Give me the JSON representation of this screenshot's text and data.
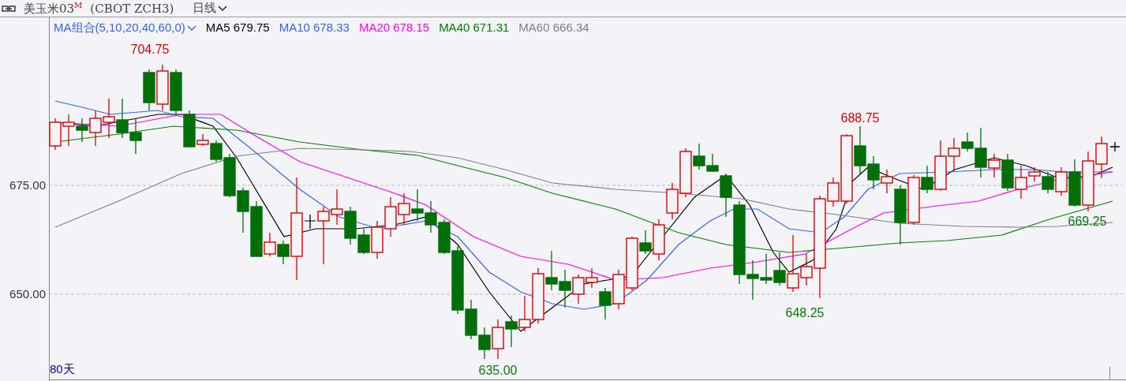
{
  "header": {
    "title": "美玉米03$^{M}$",
    "code": "(CBOT ZCH3)",
    "period": "日线"
  },
  "legend": {
    "group": "MA组合(5,10,20,40,60,0)",
    "items": [
      {
        "label": "MA5 679.75",
        "color": "#000000"
      },
      {
        "label": "MA10 678.33",
        "color": "#3366ee"
      },
      {
        "label": "MA20 678.15",
        "color": "#ff00ff"
      },
      {
        "label": "MA40 671.31",
        "color": "#008000"
      },
      {
        "label": "MA60 666.34",
        "color": "#808080"
      }
    ]
  },
  "chart": {
    "y_labels": [
      "675.00",
      "650.00"
    ],
    "annotations": [
      {
        "text": "704.75",
        "kind": "high"
      },
      {
        "text": "688.75",
        "kind": "high"
      },
      {
        "text": "648.25",
        "kind": "low"
      },
      {
        "text": "635.00",
        "kind": "low"
      },
      {
        "text": "669.25",
        "kind": "low"
      }
    ],
    "range": "80天"
  }
}
